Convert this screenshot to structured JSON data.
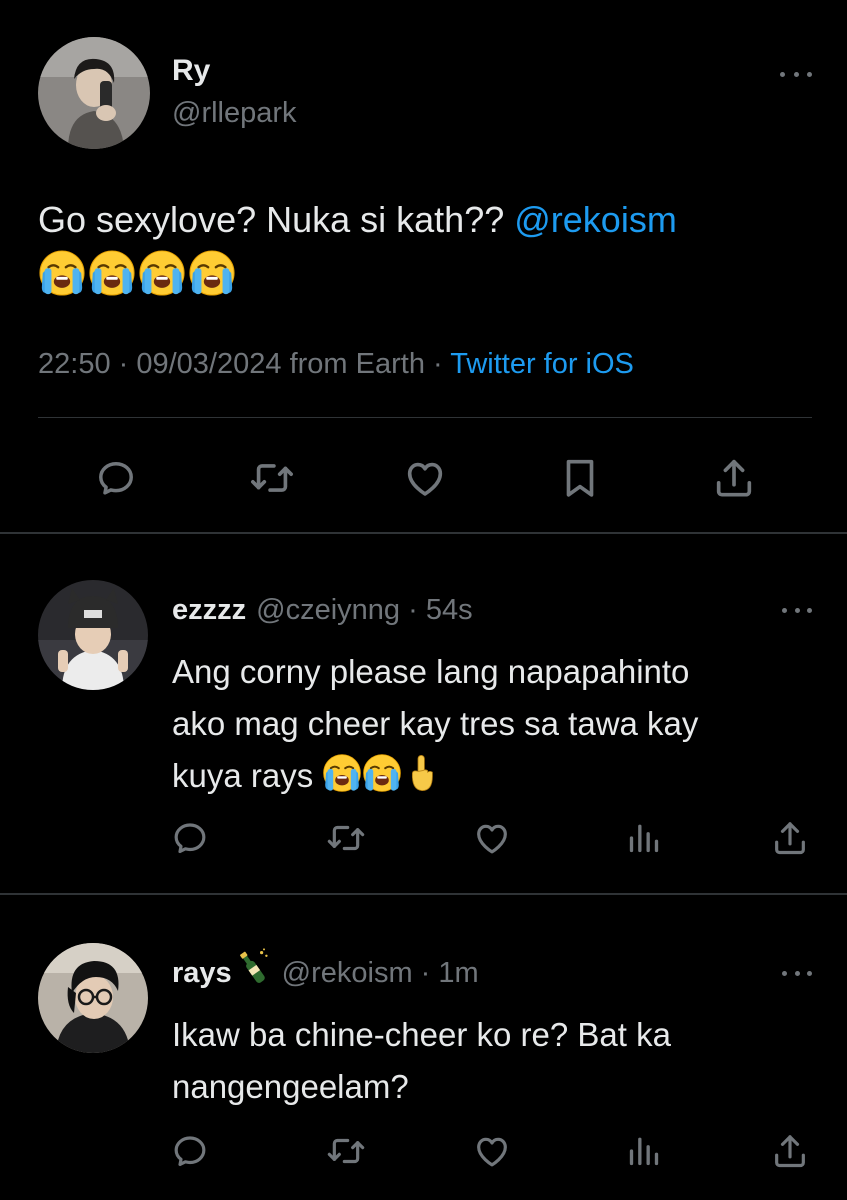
{
  "main_tweet": {
    "display_name": "Ry",
    "handle": "@rllepark",
    "text": "Go sexylove? Nuka si kath?? ",
    "mention": "@rekoism",
    "time": "22:50",
    "separator": " · ",
    "date": "09/03/2024",
    "location": " from Earth",
    "source_separator": " · ",
    "source": "Twitter for iOS",
    "emojis": [
      "loudly-crying-face",
      "loudly-crying-face",
      "loudly-crying-face",
      "loudly-crying-face"
    ],
    "actions": [
      "reply",
      "retweet",
      "like",
      "bookmark",
      "share"
    ]
  },
  "replies": [
    {
      "display_name": "ezzzz",
      "handle": "@czeiynng",
      "separator": " · ",
      "time": "54s",
      "text_line1": "Ang corny please lang napapahinto",
      "text_line2": "ako mag cheer kay tres sa tawa kay",
      "text_line3": "kuya rays ",
      "emojis": [
        "loudly-crying-face",
        "loudly-crying-face",
        "index-pointing-up"
      ],
      "actions": [
        "reply",
        "retweet",
        "like",
        "views",
        "share"
      ]
    },
    {
      "display_name": "rays",
      "name_emoji": "champagne-bottle",
      "handle": "@rekoism",
      "separator": " · ",
      "time": "1m",
      "text_line1": "Ikaw ba chine-cheer ko re? Bat ka",
      "text_line2": "nangengeelam?",
      "actions": [
        "reply",
        "retweet",
        "like",
        "views",
        "share"
      ]
    }
  ],
  "colors": {
    "background": "#000000",
    "text_primary": "#e7e9ea",
    "text_secondary": "#71767b",
    "accent": "#1d9bf0",
    "divider": "#2f3336"
  }
}
